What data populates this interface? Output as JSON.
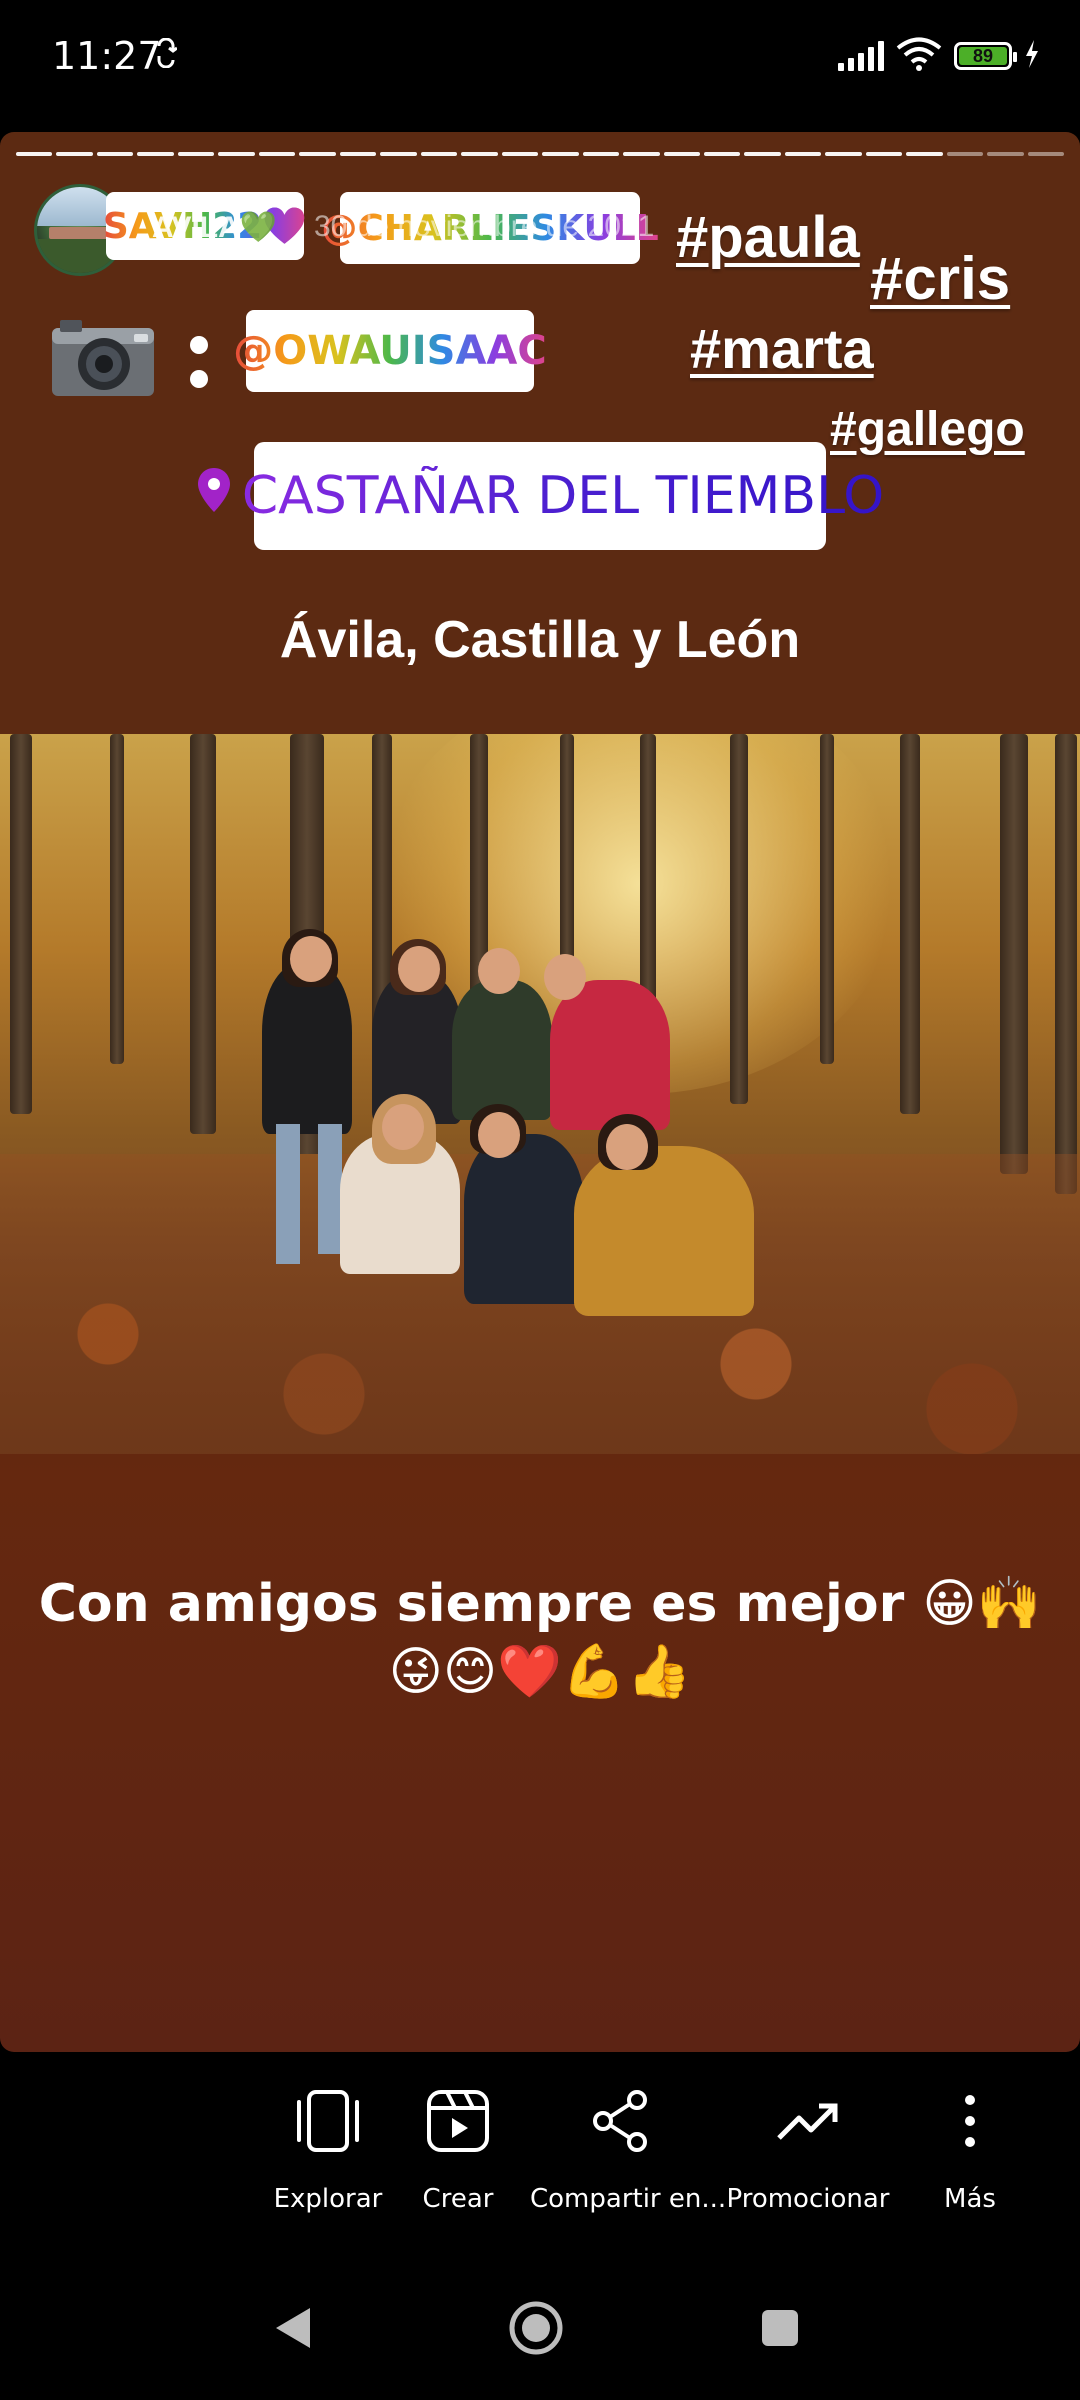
{
  "status_bar": {
    "time": "11:27",
    "battery_level": "89",
    "battery_color": "#4caf28"
  },
  "story": {
    "progress_segments_total": 26,
    "progress_segments_seen": 23,
    "user_overlay": "AVILA💚",
    "date_overlay": "30 de noviembre de 2021",
    "stickers": {
      "savh": "SAVH22💚",
      "charlie": "@CHARLIESKULL",
      "owau": "@OWAUISAAC",
      "location": "CASTAÑAR DEL TIEMBLO"
    },
    "hashtags": {
      "paula": "#paula",
      "cris": "#cris",
      "marta": "#marta",
      "gallego": "#gallego"
    },
    "place_title": "Ávila, Castilla y León",
    "caption_line1": "Con amigos siempre es mejor 😀🙌",
    "caption_line2": "😜😊❤️💪👍",
    "background_color": "#5c2a12"
  },
  "actions": {
    "explore": "Explorar",
    "create": "Crear",
    "share": "Compartir en...",
    "promote": "Promocionar",
    "more": "Más"
  },
  "icons": {
    "camera": "camera-icon",
    "pin": "location-pin-icon",
    "explore": "phone-frame-icon",
    "create": "reel-icon",
    "share": "share-icon",
    "promote": "trending-icon",
    "more": "more-vertical-icon"
  }
}
